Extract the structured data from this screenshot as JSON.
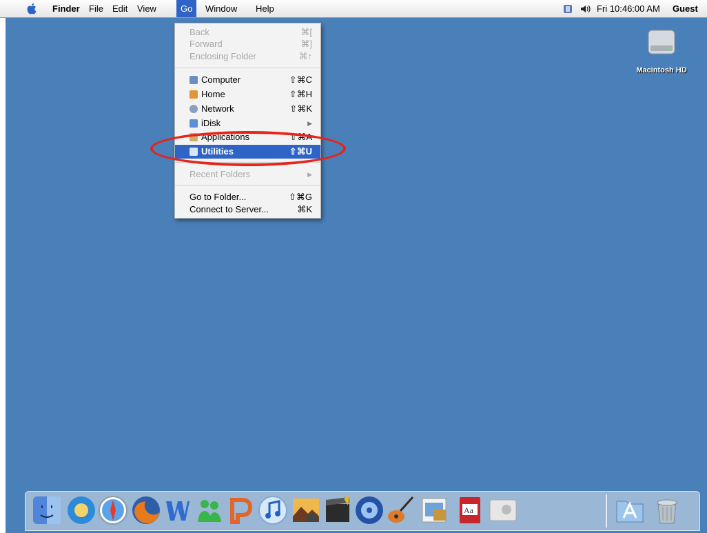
{
  "menubar": {
    "app_name": "Finder",
    "menus": [
      "File",
      "Edit",
      "View",
      "Go",
      "Window",
      "Help"
    ],
    "clock": "Fri 10:46:00 AM",
    "user": "Guest"
  },
  "go_menu": {
    "items": [
      {
        "label": "Back",
        "shortcut": "⌘[",
        "enabled": false
      },
      {
        "label": "Forward",
        "shortcut": "⌘]",
        "enabled": false
      },
      {
        "label": "Enclosing Folder",
        "shortcut": "⌘↑",
        "enabled": false
      },
      {
        "label": "Computer",
        "shortcut": "⇧⌘C",
        "icon": "computer-icon"
      },
      {
        "label": "Home",
        "shortcut": "⇧⌘H",
        "icon": "home-icon"
      },
      {
        "label": "Network",
        "shortcut": "⇧⌘K",
        "icon": "network-icon"
      },
      {
        "label": "iDisk",
        "shortcut": "▶",
        "icon": "idisk-icon"
      },
      {
        "label": "Applications",
        "shortcut": "⇧⌘A",
        "icon": "applications-icon"
      },
      {
        "label": "Utilities",
        "shortcut": "⇧⌘U",
        "icon": "utilities-icon",
        "highlighted": true
      },
      {
        "label": "Recent Folders",
        "shortcut": "▶",
        "enabled": false
      },
      {
        "label": "Go to Folder...",
        "shortcut": "⇧⌘G"
      },
      {
        "label": "Connect to Server...",
        "shortcut": "⌘K"
      }
    ]
  },
  "desktop": {
    "hd_label": "Macintosh HD",
    "background_color": "#4a80b9",
    "highlight_color": "#2f63c6",
    "annotation_color": "#e8231a"
  },
  "dock": {
    "items": [
      "finder-icon",
      "world-icon",
      "safari-icon",
      "firefox-icon",
      "word-icon",
      "messenger-icon",
      "powerpoint-icon",
      "itunes-icon",
      "iphoto-icon",
      "imovie-icon",
      "idvd-icon",
      "garageband-icon",
      "preview-icon",
      "dictionary-icon",
      "bootcamp-icon",
      "applications-folder-icon",
      "trash-icon"
    ]
  }
}
